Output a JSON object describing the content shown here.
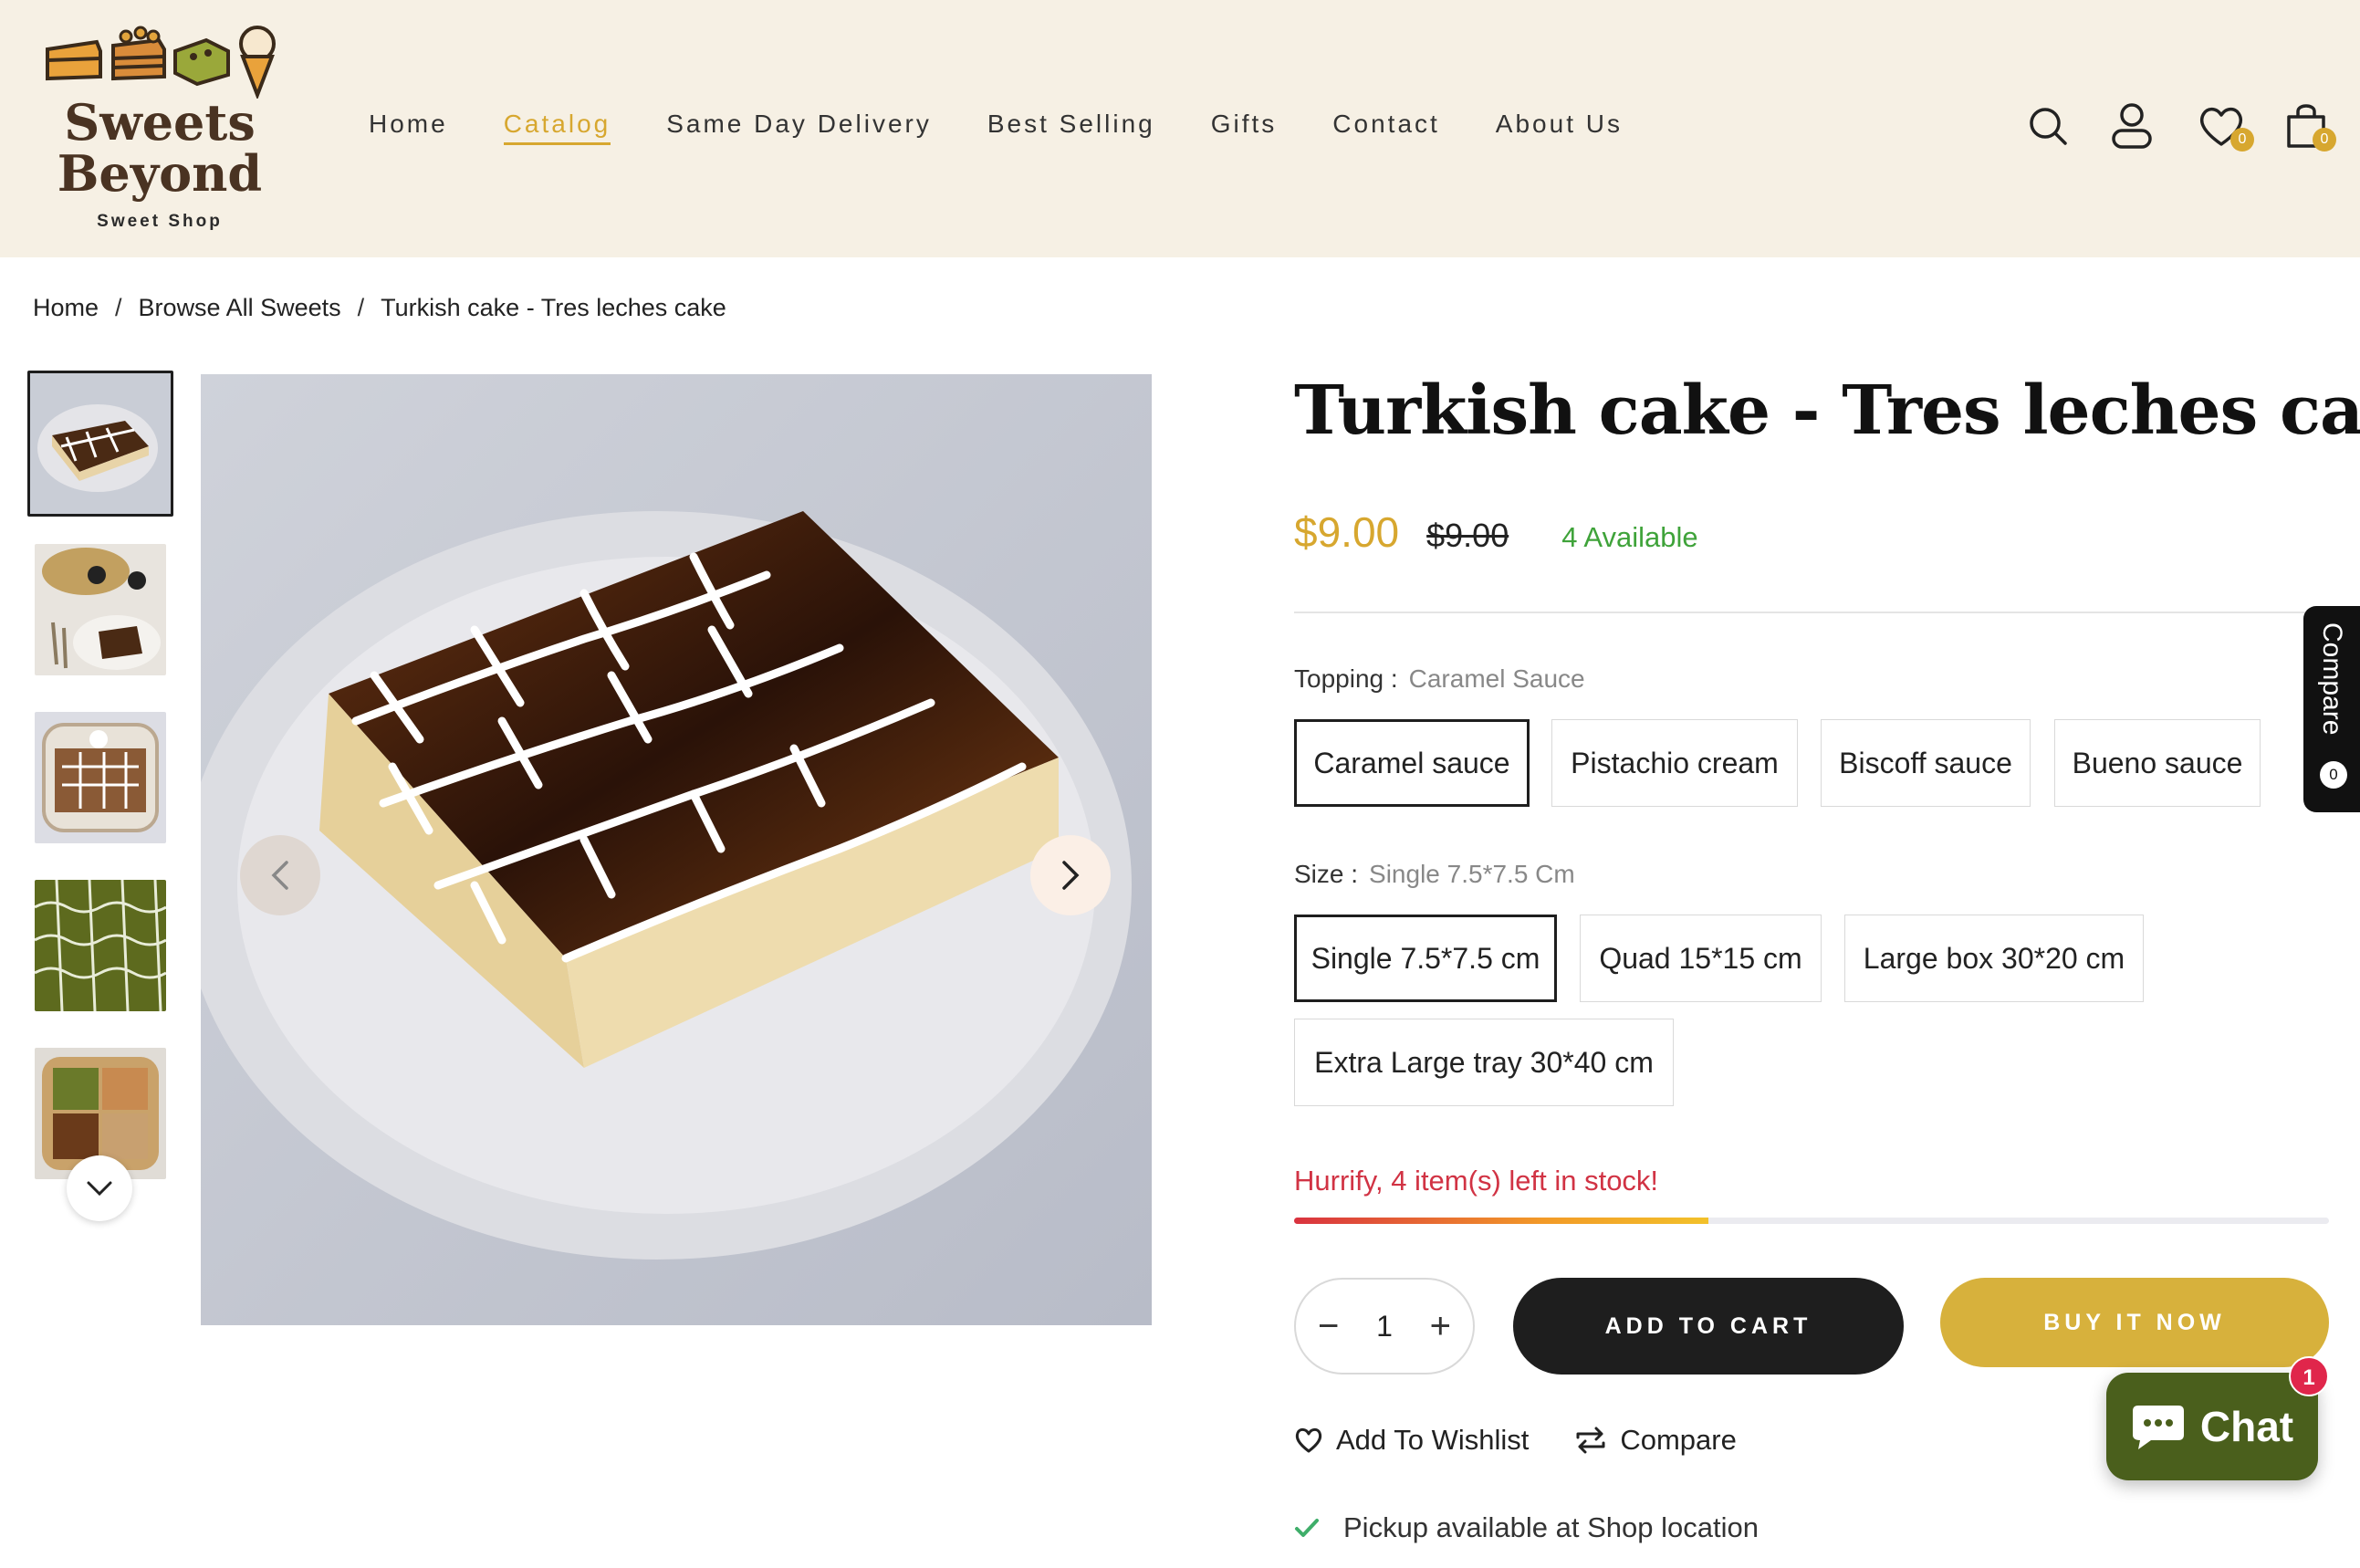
{
  "brand": {
    "name_line1": "Sweets",
    "name_line2": "Beyond",
    "tagline": "Sweet Shop"
  },
  "nav": [
    {
      "label": "Home"
    },
    {
      "label": "Catalog",
      "active": true
    },
    {
      "label": "Same Day Delivery"
    },
    {
      "label": "Best Selling"
    },
    {
      "label": "Gifts"
    },
    {
      "label": "Contact"
    },
    {
      "label": "About Us"
    }
  ],
  "header_icons": {
    "wishlist_count": "0",
    "cart_count": "0"
  },
  "breadcrumb": [
    "Home",
    "Browse All Sweets",
    "Turkish cake - Tres leches cake"
  ],
  "product": {
    "title": "Turkish cake - Tres leches cake",
    "price": "$9.00",
    "compare_price": "$9.00",
    "availability": "4 Available",
    "topping": {
      "label": "Topping :",
      "selected_value": "Caramel Sauce",
      "options": [
        "Caramel sauce",
        "Pistachio cream",
        "Biscoff sauce",
        "Bueno sauce"
      ]
    },
    "size": {
      "label": "Size :",
      "selected_value": "Single 7.5*7.5 Cm",
      "options": [
        "Single 7.5*7.5 cm",
        "Quad 15*15 cm",
        "Large box 30*20 cm",
        "Extra Large tray 30*40 cm"
      ]
    },
    "stock_message": "Hurrify, 4 item(s) left in stock!",
    "stock_level_fraction": 0.4,
    "quantity": "1",
    "add_to_cart_label": "ADD TO CART",
    "buy_now_label": "BUY IT NOW",
    "wishlist_label": "Add To Wishlist",
    "compare_label": "Compare",
    "pickup_text": "Pickup available at Shop location"
  },
  "compare_tab": {
    "label": "Compare",
    "count": "0"
  },
  "chat_widget": {
    "label": "Chat",
    "badge": "1"
  },
  "colors": {
    "accent": "#d7a72f",
    "header_bg": "#f6f0e4",
    "stock_red": "#d13344",
    "available_green": "#3fa33a",
    "chat_bg": "#4a5f1c"
  }
}
